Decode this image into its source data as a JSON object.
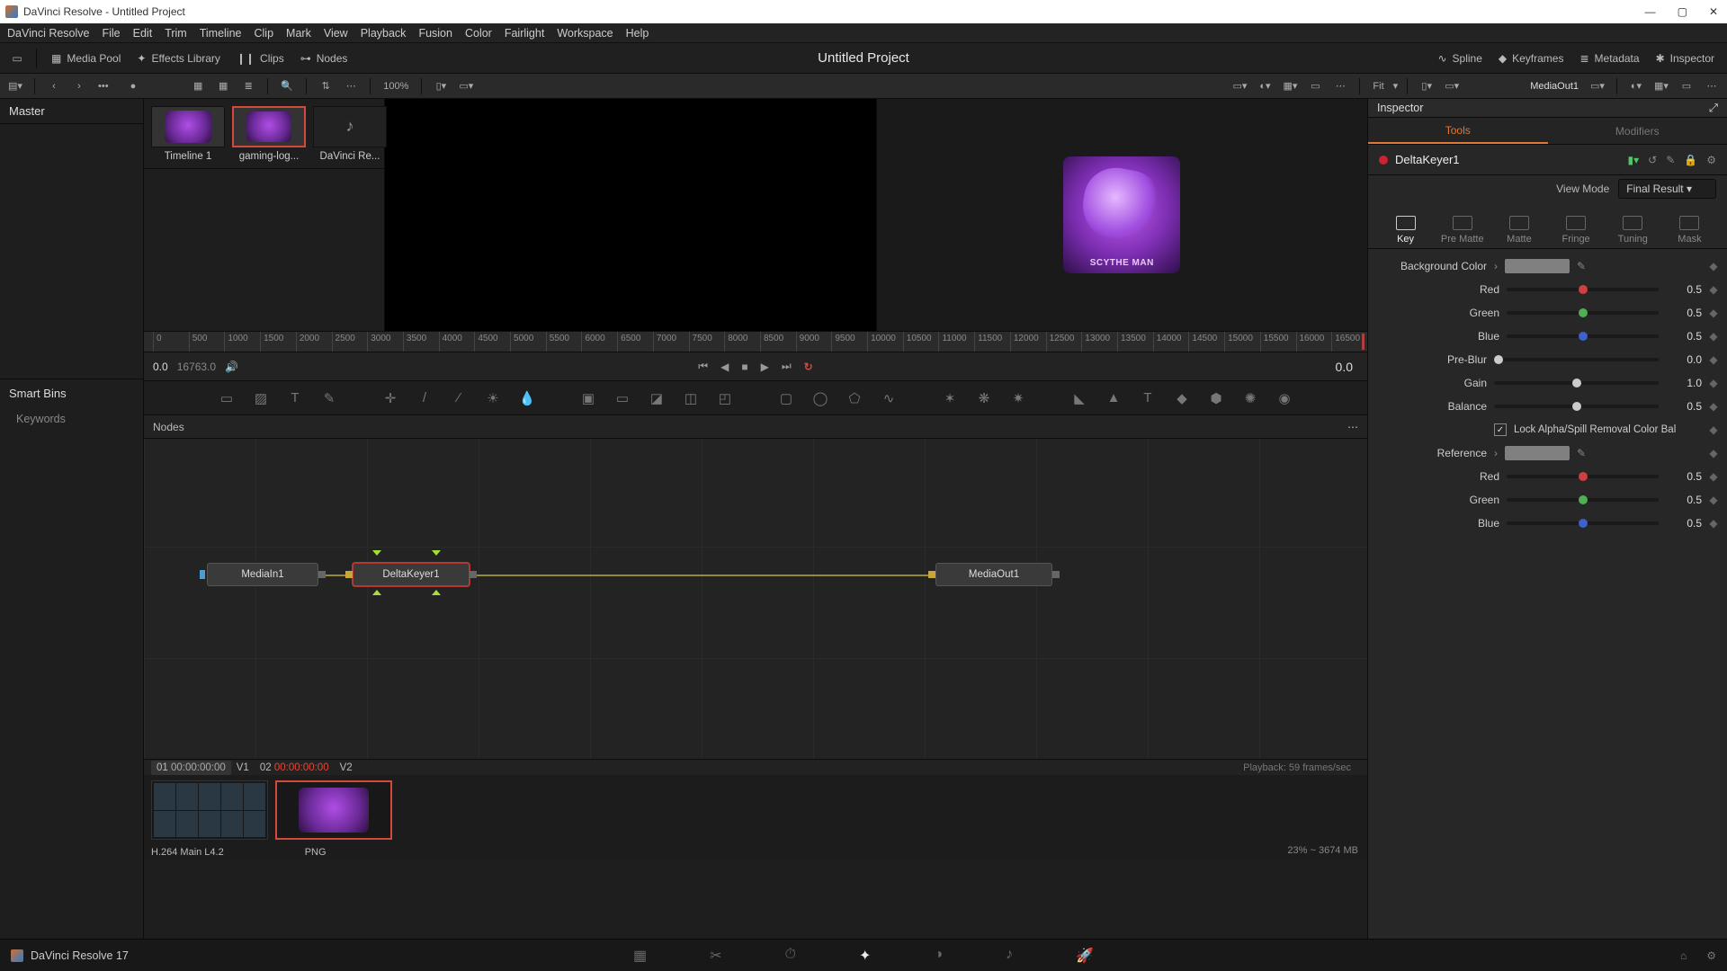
{
  "title_bar": {
    "text": "DaVinci Resolve - Untitled Project"
  },
  "menu": [
    "DaVinci Resolve",
    "File",
    "Edit",
    "Trim",
    "Timeline",
    "Clip",
    "Mark",
    "View",
    "Playback",
    "Fusion",
    "Color",
    "Fairlight",
    "Workspace",
    "Help"
  ],
  "project_title": "Untitled Project",
  "top_toolbar": {
    "media_pool": "Media Pool",
    "effects_library": "Effects Library",
    "clips": "Clips",
    "nodes": "Nodes",
    "spline": "Spline",
    "keyframes": "Keyframes",
    "metadata": "Metadata",
    "inspector": "Inspector"
  },
  "sub_toolbar": {
    "zoom": "100%",
    "fit": "Fit",
    "viewer_node": "MediaOut1"
  },
  "media_panel": {
    "master": "Master",
    "smart_bins": "Smart Bins",
    "keywords": "Keywords",
    "thumbs": [
      {
        "label": "Timeline 1",
        "kind": "purple"
      },
      {
        "label": "gaming-log...",
        "kind": "purple",
        "selected": true
      },
      {
        "label": "DaVinci Re...",
        "kind": "audio"
      }
    ]
  },
  "viewer": {
    "logo_text": "SCYTHE MAN"
  },
  "ruler_ticks": [
    "0",
    "500",
    "1000",
    "1500",
    "2000",
    "2500",
    "3000",
    "3500",
    "4000",
    "4500",
    "5000",
    "5500",
    "6000",
    "6500",
    "7000",
    "7500",
    "8000",
    "8500",
    "9000",
    "9500",
    "10000",
    "10500",
    "11000",
    "11500",
    "12000",
    "12500",
    "13000",
    "13500",
    "14000",
    "14500",
    "15000",
    "15500",
    "16000",
    "16500"
  ],
  "transport": {
    "start": "0.0",
    "total": "16763.0",
    "end": "0.0"
  },
  "nodes_header": "Nodes",
  "nodes": {
    "a": "MediaIn1",
    "b": "DeltaKeyer1",
    "c": "MediaOut1"
  },
  "clip_tabs": {
    "t1_id": "01",
    "t1_tc": "00:00:00:00",
    "t1_track": "V1",
    "t2_id": "02",
    "t2_tc": "00:00:00:00",
    "t2_track": "V2"
  },
  "clip_meta": {
    "a": "H.264 Main L4.2",
    "b": "PNG"
  },
  "playback_status": "Playback: 59 frames/sec",
  "memory_status": "23% ~ 3674 MB",
  "inspector": {
    "title": "Inspector",
    "tabs": {
      "tools": "Tools",
      "modifiers": "Modifiers"
    },
    "node_name": "DeltaKeyer1",
    "view_mode_label": "View Mode",
    "view_mode_value": "Final Result",
    "tool_tabs": [
      "Key",
      "Pre Matte",
      "Matte",
      "Fringe",
      "Tuning",
      "Mask"
    ],
    "bg_label": "Background Color",
    "colors": {
      "red_l": "Red",
      "green_l": "Green",
      "blue_l": "Blue"
    },
    "values": {
      "bg_r": "0.5",
      "bg_g": "0.5",
      "bg_b": "0.5",
      "preblur_l": "Pre-Blur",
      "preblur_v": "0.0",
      "gain_l": "Gain",
      "gain_v": "1.0",
      "balance_l": "Balance",
      "balance_v": "0.5",
      "lock_label": "Lock Alpha/Spill Removal Color Bal",
      "ref_label": "Reference",
      "ref_r": "0.5",
      "ref_g": "0.5",
      "ref_b": "0.5"
    }
  },
  "app_footer": "DaVinci Resolve 17"
}
